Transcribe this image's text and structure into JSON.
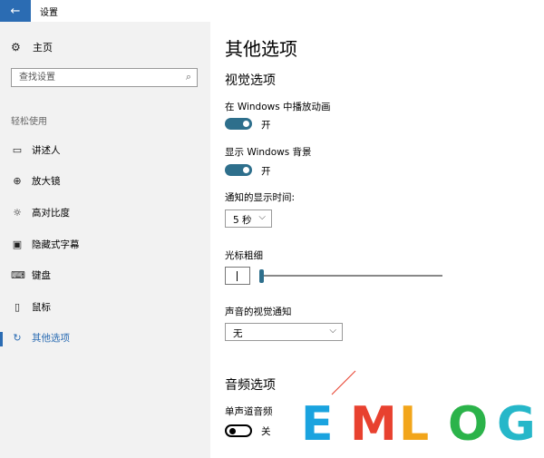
{
  "titlebar": {
    "back_icon": "arrow-left-icon",
    "title": "设置"
  },
  "sidebar": {
    "home_label": "主页",
    "search_placeholder": "查找设置",
    "section_label": "轻松使用",
    "items": [
      {
        "label": "讲述人",
        "icon": "narrator-icon"
      },
      {
        "label": "放大镜",
        "icon": "magnifier-icon"
      },
      {
        "label": "高对比度",
        "icon": "high-contrast-icon"
      },
      {
        "label": "隐藏式字幕",
        "icon": "closed-captions-icon"
      },
      {
        "label": "键盘",
        "icon": "keyboard-icon"
      },
      {
        "label": "鼠标",
        "icon": "mouse-icon"
      },
      {
        "label": "其他选项",
        "icon": "other-options-icon",
        "active": true
      }
    ]
  },
  "main": {
    "title": "其他选项",
    "visual_heading": "视觉选项",
    "animations": {
      "label": "在 Windows 中播放动画",
      "state": "开",
      "on": true
    },
    "background": {
      "label": "显示 Windows 背景",
      "state": "开",
      "on": true
    },
    "notify_time": {
      "label": "通知的显示时间:",
      "value": "5 秒"
    },
    "cursor": {
      "label": "光标粗细",
      "caret": "|",
      "level": 0
    },
    "visual_notify": {
      "label": "声音的视觉通知",
      "value": "无"
    },
    "audio_heading": "音频选项",
    "mono": {
      "label": "单声道音频",
      "state": "关",
      "on": false
    }
  },
  "watermark": {
    "text": "EMLOG",
    "colors": [
      "#1aa3df",
      "#e8412f",
      "#f2a51a",
      "#2bb34a",
      "#26b7c9"
    ]
  },
  "colors": {
    "accent": "#2b6cb3",
    "toggle_on": "#2e6f8c",
    "sidebar_bg": "#f2f2f2"
  }
}
